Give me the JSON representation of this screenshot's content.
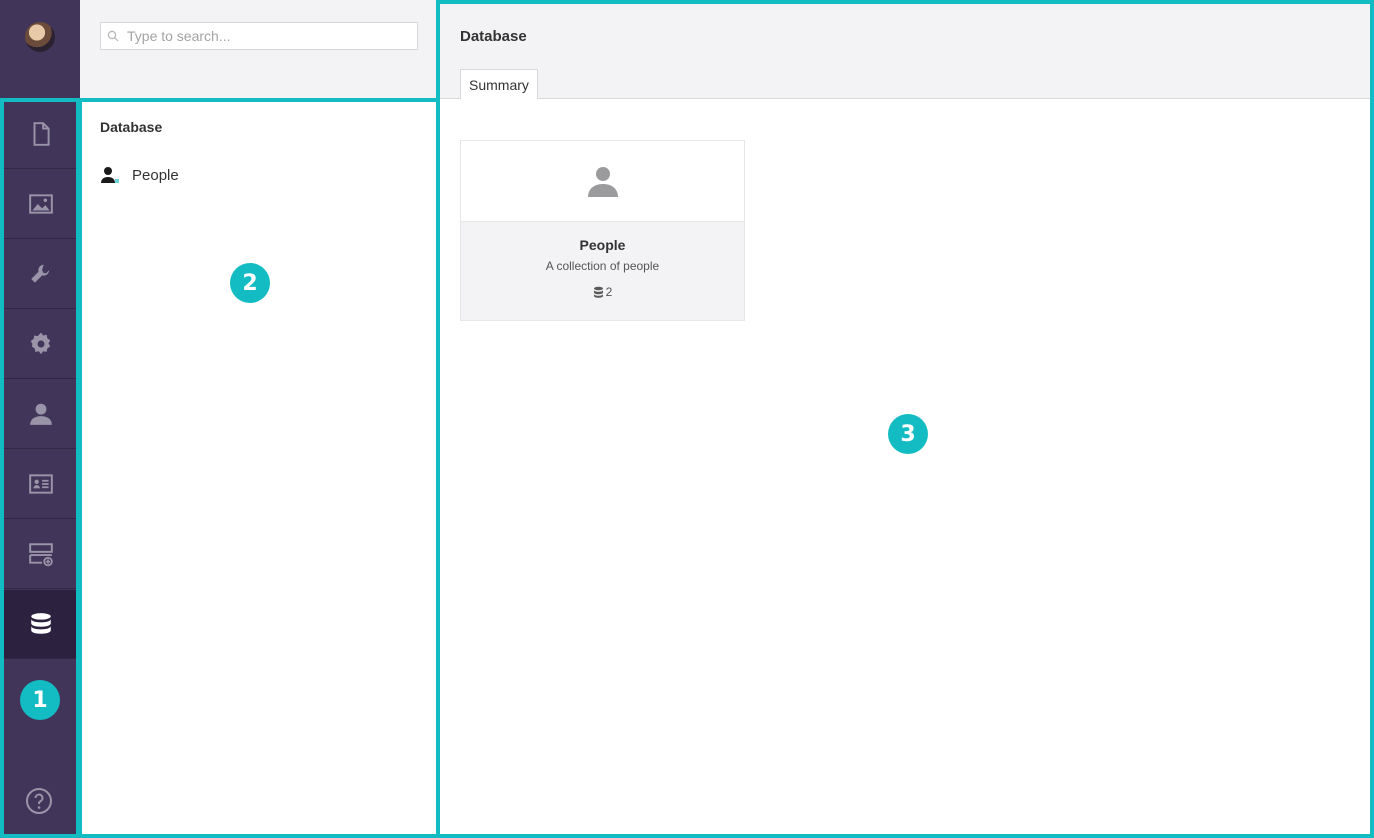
{
  "colors": {
    "accent": "#13bcc3",
    "sidebar": "#413659",
    "sidebar_active": "#2c2240",
    "icon": "#9a94a8"
  },
  "sidebar": {
    "avatar": "user-avatar",
    "items": [
      {
        "name": "content",
        "icon": "document-icon"
      },
      {
        "name": "media",
        "icon": "image-icon"
      },
      {
        "name": "settings",
        "icon": "wrench-icon"
      },
      {
        "name": "packages",
        "icon": "gear-icon"
      },
      {
        "name": "users",
        "icon": "user-icon"
      },
      {
        "name": "members",
        "icon": "id-card-icon"
      },
      {
        "name": "forms",
        "icon": "form-add-icon"
      },
      {
        "name": "database",
        "icon": "database-icon",
        "active": true
      }
    ],
    "help_icon": "help-icon"
  },
  "search": {
    "placeholder": "Type to search..."
  },
  "tree": {
    "title": "Database",
    "items": [
      {
        "label": "People",
        "icon": "people-icon"
      }
    ]
  },
  "main": {
    "title": "Database",
    "tabs": [
      {
        "label": "Summary",
        "active": true
      }
    ],
    "cards": [
      {
        "name": "People",
        "description": "A collection of people",
        "count": "2"
      }
    ]
  },
  "annotations": [
    "1",
    "2",
    "3"
  ]
}
